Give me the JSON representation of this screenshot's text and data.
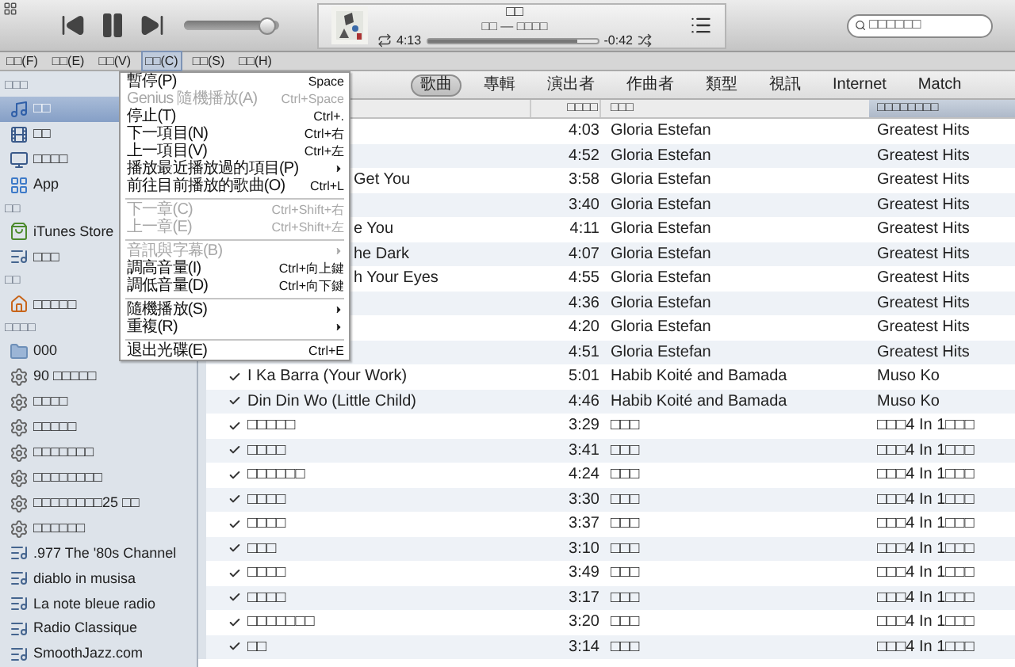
{
  "player": {
    "volume": {
      "level": 0.97
    },
    "now_playing": {
      "title": "□□",
      "subtitle": "□□ — □□□□",
      "elapsed": "4:13",
      "remaining": "-0:42",
      "progress": {
        "level": 0.88
      }
    },
    "search": {
      "placeholder": "□□□□□□"
    }
  },
  "menu_bar": [
    {
      "label": "□□(F)",
      "selected": false
    },
    {
      "label": "□□(E)",
      "selected": false
    },
    {
      "label": "□□(V)",
      "selected": false
    },
    {
      "label": "□□(C)",
      "selected": true
    },
    {
      "label": "□□(S)",
      "selected": false
    },
    {
      "label": "□□(H)",
      "selected": false
    }
  ],
  "sidebar": {
    "sections": [
      {
        "heading": "□□□",
        "items": [
          {
            "label": "□□",
            "kind": "music",
            "selected": true
          },
          {
            "label": "□□",
            "kind": "film",
            "selected": false
          },
          {
            "label": "□□□□",
            "kind": "tv",
            "selected": false
          },
          {
            "label": "App",
            "kind": "app",
            "selected": false
          }
        ]
      },
      {
        "heading": "□□",
        "items": [
          {
            "label": "iTunes Store",
            "kind": "store",
            "selected": false
          },
          {
            "label": "□□□",
            "kind": "radio",
            "selected": false
          }
        ]
      },
      {
        "heading": "□□",
        "items": [
          {
            "label": "□□□□□",
            "kind": "home",
            "selected": false
          }
        ]
      },
      {
        "heading": "□□□□",
        "items": [
          {
            "label": "000",
            "kind": "folder",
            "selected": false
          },
          {
            "label": "90 □□□□□",
            "kind": "smart",
            "selected": false
          },
          {
            "label": "□□□□",
            "kind": "smart",
            "selected": false
          },
          {
            "label": "□□□□□",
            "kind": "smart",
            "selected": false
          },
          {
            "label": "□□□□□□□",
            "kind": "smart",
            "selected": false
          },
          {
            "label": "□□□□□□□□",
            "kind": "smart",
            "selected": false
          },
          {
            "label": "□□□□□□□□25 □□",
            "kind": "smart",
            "selected": false
          },
          {
            "label": "□□□□□□",
            "kind": "smart",
            "selected": false
          },
          {
            "label": ".977 The '80s Channel",
            "kind": "radio",
            "selected": false
          },
          {
            "label": "diablo in musisa",
            "kind": "radio",
            "selected": false
          },
          {
            "label": "La note bleue radio",
            "kind": "radio",
            "selected": false
          },
          {
            "label": "Radio Classique",
            "kind": "radio",
            "selected": false
          },
          {
            "label": "SmoothJazz.com",
            "kind": "radio",
            "selected": false
          }
        ]
      }
    ]
  },
  "controls_menu": [
    {
      "kind": "item",
      "label": "暫停(P)",
      "shortcut": "Space",
      "disabled": false,
      "submenu": false
    },
    {
      "kind": "item",
      "label": "Genius 隨機播放(A)",
      "shortcut": "Ctrl+Space",
      "disabled": true,
      "submenu": false
    },
    {
      "kind": "item",
      "label": "停止(T)",
      "shortcut": "Ctrl+.",
      "disabled": false,
      "submenu": false
    },
    {
      "kind": "item",
      "label": "下一項目(N)",
      "shortcut": "Ctrl+右",
      "disabled": false,
      "submenu": false
    },
    {
      "kind": "item",
      "label": "上一項目(V)",
      "shortcut": "Ctrl+左",
      "disabled": false,
      "submenu": false
    },
    {
      "kind": "item",
      "label": "播放最近播放過的項目(P)",
      "disabled": false,
      "submenu": true
    },
    {
      "kind": "item",
      "label": "前往目前播放的歌曲(O)",
      "shortcut": "Ctrl+L",
      "disabled": false,
      "submenu": false
    },
    {
      "kind": "separator"
    },
    {
      "kind": "item",
      "label": "下一章(C)",
      "shortcut": "Ctrl+Shift+右",
      "disabled": true,
      "submenu": false
    },
    {
      "kind": "item",
      "label": "上一章(E)",
      "shortcut": "Ctrl+Shift+左",
      "disabled": true,
      "submenu": false
    },
    {
      "kind": "separator"
    },
    {
      "kind": "item",
      "label": "音訊與字幕(B)",
      "disabled": true,
      "submenu": true
    },
    {
      "kind": "item",
      "label": "調高音量(I)",
      "shortcut": "Ctrl+向上鍵",
      "disabled": false,
      "submenu": false
    },
    {
      "kind": "item",
      "label": "調低音量(D)",
      "shortcut": "Ctrl+向下鍵",
      "disabled": false,
      "submenu": false
    },
    {
      "kind": "separator"
    },
    {
      "kind": "item",
      "label": "隨機播放(S)",
      "disabled": false,
      "submenu": true
    },
    {
      "kind": "item",
      "label": "重複(R)",
      "disabled": false,
      "submenu": true
    },
    {
      "kind": "separator"
    },
    {
      "kind": "item",
      "label": "退出光碟(E)",
      "shortcut": "Ctrl+E",
      "disabled": false,
      "submenu": false
    }
  ],
  "view_tabs": [
    {
      "label": "歌曲",
      "selected": true
    },
    {
      "label": "專輯",
      "selected": false
    },
    {
      "label": "演出者",
      "selected": false
    },
    {
      "label": "作曲者",
      "selected": false
    },
    {
      "label": "類型",
      "selected": false
    },
    {
      "label": "視訊",
      "selected": false
    },
    {
      "label": "Internet",
      "selected": false
    },
    {
      "label": "Match",
      "selected": false
    }
  ],
  "song_list": {
    "columns": [
      {
        "label": "□□□□",
        "sorted": false
      },
      {
        "label": "□□□",
        "sorted": false
      },
      {
        "label": "□□□□□□□□",
        "sorted": true
      }
    ],
    "rows": [
      {
        "time": "4:03",
        "artist": "Gloria Estefan",
        "album": "Greatest Hits"
      },
      {
        "time": "4:52",
        "artist": "Gloria Estefan",
        "album": "Greatest Hits"
      },
      {
        "name": "Get You",
        "time": "3:58",
        "artist": "Gloria Estefan",
        "album": "Greatest Hits"
      },
      {
        "time": "3:40",
        "artist": "Gloria Estefan",
        "album": "Greatest Hits"
      },
      {
        "name": "e You",
        "time": "4:11",
        "artist": "Gloria Estefan",
        "album": "Greatest Hits"
      },
      {
        "name": "he Dark",
        "time": "4:07",
        "artist": "Gloria Estefan",
        "album": "Greatest Hits"
      },
      {
        "name": "h Your Eyes",
        "time": "4:55",
        "artist": "Gloria Estefan",
        "album": "Greatest Hits"
      },
      {
        "time": "4:36",
        "artist": "Gloria Estefan",
        "album": "Greatest Hits"
      },
      {
        "time": "4:20",
        "artist": "Gloria Estefan",
        "album": "Greatest Hits"
      },
      {
        "time": "4:51",
        "artist": "Gloria Estefan",
        "album": "Greatest Hits"
      },
      {
        "name": "I Ka Barra (Your Work)",
        "checked": true,
        "time": "5:01",
        "artist": "Habib Koité and Bamada",
        "album": "Muso Ko"
      },
      {
        "name": "Din Din Wo (Little Child)",
        "checked": true,
        "time": "4:46",
        "artist": "Habib Koité and Bamada",
        "album": "Muso Ko"
      },
      {
        "name": "□□□□□",
        "checked": true,
        "time": "3:29",
        "artist": "□□□",
        "album": "□□□4 In 1□□□"
      },
      {
        "name": "□□□□",
        "checked": true,
        "time": "3:41",
        "artist": "□□□",
        "album": "□□□4 In 1□□□"
      },
      {
        "name": "□□□□□□",
        "checked": true,
        "time": "4:24",
        "artist": "□□□",
        "album": "□□□4 In 1□□□"
      },
      {
        "name": "□□□□",
        "checked": true,
        "time": "3:30",
        "artist": "□□□",
        "album": "□□□4 In 1□□□"
      },
      {
        "name": "□□□□",
        "checked": true,
        "time": "3:37",
        "artist": "□□□",
        "album": "□□□4 In 1□□□"
      },
      {
        "name": "□□□",
        "checked": true,
        "time": "3:10",
        "artist": "□□□",
        "album": "□□□4 In 1□□□"
      },
      {
        "name": "□□□□",
        "checked": true,
        "time": "3:49",
        "artist": "□□□",
        "album": "□□□4 In 1□□□"
      },
      {
        "name": "□□□□",
        "checked": true,
        "time": "3:17",
        "artist": "□□□",
        "album": "□□□4 In 1□□□"
      },
      {
        "name": "□□□□□□□",
        "checked": true,
        "time": "3:20",
        "artist": "□□□",
        "album": "□□□4 In 1□□□"
      },
      {
        "name": "□□",
        "checked": true,
        "time": "3:14",
        "artist": "□□□",
        "album": "□□□4 In 1□□□"
      }
    ]
  }
}
